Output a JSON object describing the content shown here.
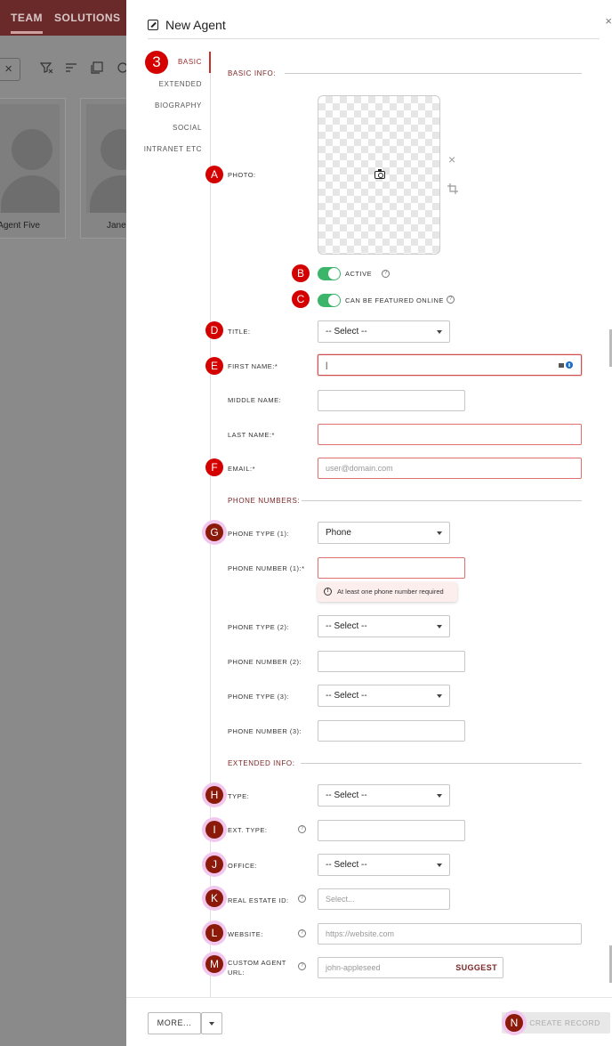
{
  "background": {
    "nav": [
      "TEAM",
      "SOLUTIONS"
    ],
    "cards": [
      {
        "name": "Agent Five"
      },
      {
        "name": "Jane"
      }
    ]
  },
  "modal": {
    "title": "New Agent",
    "close_glyph": "×",
    "sidenav": [
      "BASIC",
      "EXTENDED",
      "BIOGRAPHY",
      "SOCIAL",
      "INTRANET ETC"
    ],
    "sections": {
      "basic": "BASIC INFO:",
      "phones": "PHONE NUMBERS:",
      "extended": "EXTENDED INFO:"
    },
    "photo": {
      "label": "PHOTO:",
      "remove_glyph": "×"
    },
    "active": {
      "label": "ACTIVE",
      "value": true
    },
    "featured": {
      "label": "CAN BE FEATURED ONLINE",
      "value": true
    },
    "title_field": {
      "label": "TITLE:",
      "value": "-- Select --"
    },
    "first_name": {
      "label": "FIRST NAME:*",
      "value": "|"
    },
    "middle_name": {
      "label": "MIDDLE NAME:"
    },
    "last_name": {
      "label": "LAST NAME:*"
    },
    "email": {
      "label": "EMAIL:*",
      "placeholder": "user@domain.com"
    },
    "phone_type_1": {
      "label": "PHONE TYPE (1):",
      "value": "Phone"
    },
    "phone_number_1": {
      "label": "PHONE NUMBER (1):*"
    },
    "phone_error": "At least one phone number required",
    "phone_type_2": {
      "label": "PHONE TYPE (2):",
      "value": "-- Select --"
    },
    "phone_number_2": {
      "label": "PHONE NUMBER (2):"
    },
    "phone_type_3": {
      "label": "PHONE TYPE (3):",
      "value": "-- Select --"
    },
    "phone_number_3": {
      "label": "PHONE NUMBER (3):"
    },
    "type": {
      "label": "TYPE:",
      "value": "-- Select --"
    },
    "ext_type": {
      "label": "EXT. TYPE:"
    },
    "office": {
      "label": "OFFICE:",
      "value": "-- Select --"
    },
    "real_estate_id": {
      "label": "REAL ESTATE ID:",
      "placeholder": "Select..."
    },
    "website": {
      "label": "WEBSITE:",
      "placeholder": "https://website.com"
    },
    "custom_url": {
      "label_1": "CUSTOM AGENT",
      "label_2": "URL:",
      "placeholder": "john-appleseed",
      "suggest": "SUGGEST"
    },
    "help_glyph": "?",
    "warn_glyph": "!"
  },
  "footer": {
    "more": "MORE...",
    "create": "CREATE RECORD"
  },
  "badges": {
    "step": "3",
    "A": "A",
    "B": "B",
    "C": "C",
    "D": "D",
    "E": "E",
    "F": "F",
    "G": "G",
    "H": "H",
    "I": "I",
    "J": "J",
    "K": "K",
    "L": "L",
    "M": "M",
    "N": "N"
  },
  "colors": {
    "accent": "#9b2c2c",
    "badge_red": "#d40000",
    "badge_dark": "#8b1a0a",
    "toggle_on": "#3bb56a",
    "error_border": "#e07070"
  }
}
